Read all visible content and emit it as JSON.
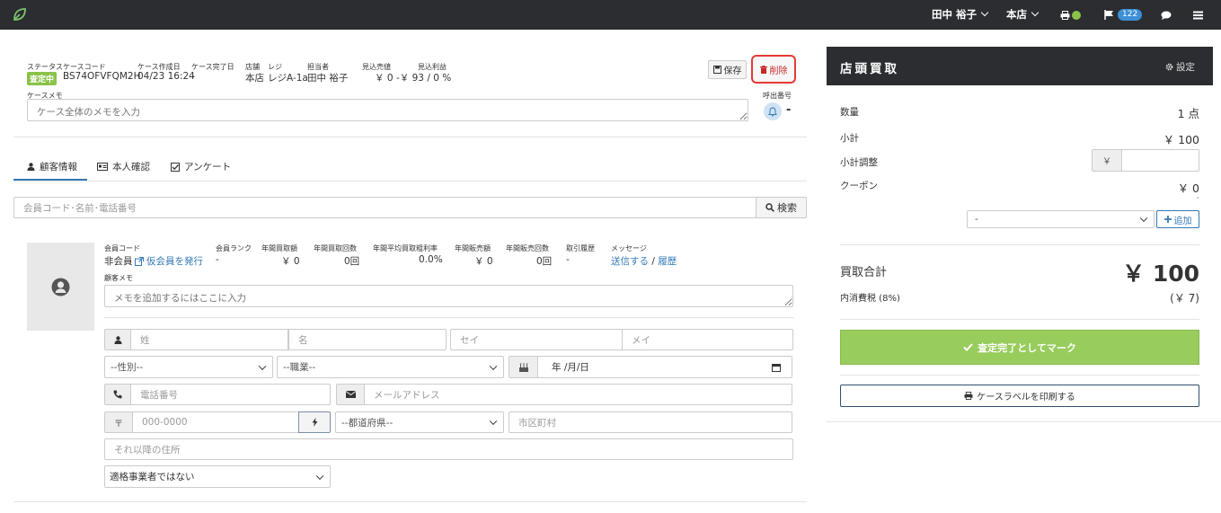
{
  "topbar": {
    "user": "田中 裕子",
    "store": "本店",
    "notification_count": "122"
  },
  "case": {
    "status_label": "ステータス",
    "status_value": "査定中",
    "code_label": "ケースコード",
    "code_value": "BS74OFVFQM2H",
    "created_label": "ケース作成日",
    "created_value": "04/23 16:24",
    "completed_label": "ケース完了日",
    "completed_value": "-",
    "store_label": "店舗",
    "store_value": "本店",
    "register_label": "レジ",
    "register_value": "レジA-1a",
    "staff_label": "担当者",
    "staff_value": "田中 裕子",
    "est_sales_label": "見込売値",
    "est_sales_value": "￥ 0",
    "est_profit_label": "見込利益",
    "est_profit_value": "-￥ 93 / 0 %",
    "memo_label": "ケースメモ",
    "memo_placeholder": "ケース全体のメモを入力",
    "call_label": "呼出番号",
    "call_value": "-",
    "save_label": "保存",
    "delete_label": "削除"
  },
  "tabs": [
    {
      "label": "顧客情報"
    },
    {
      "label": "本人確認"
    },
    {
      "label": "アンケート"
    }
  ],
  "search": {
    "placeholder": "会員コード･名前･電話番号",
    "button_label": "検索"
  },
  "customer": {
    "member_code_label": "会員コード",
    "member_code_value": "非会員",
    "issue_temp_label": "仮会員を発行",
    "rank_label": "会員ランク",
    "rank_value": "-",
    "annual_amount_label": "年間買取額",
    "annual_amount_value": "￥ 0",
    "annual_count_label": "年間買取回数",
    "annual_count_value": "0回",
    "avg_margin_label": "年間平均買取粗利率",
    "avg_margin_value": "0.0%",
    "annual_sales_label": "年間販売額",
    "annual_sales_value": "￥ 0",
    "annual_sales_count_label": "年間販売回数",
    "annual_sales_count_value": "0回",
    "deny_label": "取引履歴",
    "deny_value": "-",
    "message_label": "メッセージ",
    "send_label": "送信する",
    "history_label": "履歴",
    "memo_label": "顧客メモ",
    "memo_placeholder": "メモを追加するにはここに入力",
    "last_name_placeholder": "姓",
    "first_name_placeholder": "名",
    "last_kana_placeholder": "セイ",
    "first_kana_placeholder": "メイ",
    "gender_value": "--性別--",
    "job_value": "--職業--",
    "birth_placeholder": "年 /月/日",
    "phone_placeholder": "電話番号",
    "email_placeholder": "メールアドレス",
    "zip_placeholder": "000-0000",
    "zip_prefix": "〒",
    "pref_value": "--都道府県--",
    "city_placeholder": "市区町村",
    "address_placeholder": "それ以降の住所",
    "qualification_value": "適格事業者ではない"
  },
  "panel": {
    "title": "店頭買取",
    "settings_label": "設定",
    "qty_label": "数量",
    "qty_value": "1 点",
    "subtotal_label": "小計",
    "subtotal_value": "￥ 100",
    "adjust_label": "小計調整",
    "adjust_prefix": "￥",
    "coupon_label": "クーポン",
    "coupon_value": "￥ 0",
    "coupon_dash": "-",
    "coupon_select": "-",
    "add_label": "追加",
    "total_label": "買取合計",
    "total_value": "￥ 100",
    "tax_label": "内消費税 (8%)",
    "tax_value": "(￥ 7)",
    "complete_label": "査定完了としてマーク",
    "print_label": "ケースラベルを印刷する"
  }
}
